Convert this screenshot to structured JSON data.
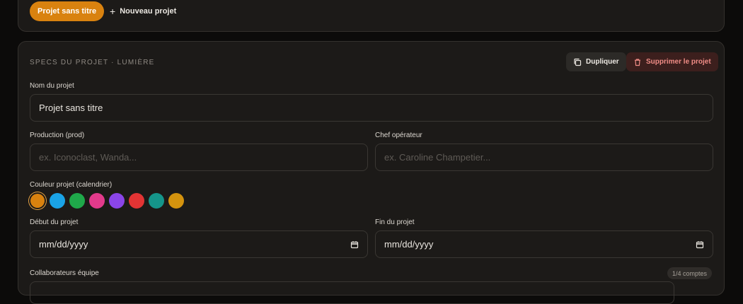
{
  "tabs": {
    "active_project": "Projet sans titre",
    "new_project_label": "Nouveau projet"
  },
  "specs": {
    "section_title": "SPECS DU PROJET · LUMIÈRE",
    "duplicate_label": "Dupliquer",
    "delete_label": "Supprimer le projet",
    "name_label": "Nom du projet",
    "name_value": "Projet sans titre",
    "production_label": "Production (prod)",
    "production_placeholder": "ex. Iconoclast, Wanda...",
    "dop_label": "Chef opérateur",
    "dop_placeholder": "ex. Caroline Champetier...",
    "color_label": "Couleur projet (calendrier)",
    "colors": [
      "#d9820f",
      "#1aa3e6",
      "#1fa84a",
      "#e23a8b",
      "#8a45e8",
      "#e23434",
      "#15958a",
      "#d4930e"
    ],
    "selected_color_index": 0,
    "start_label": "Début du projet",
    "start_value": "mm/dd/yyyy",
    "end_label": "Fin du projet",
    "end_value": "mm/dd/yyyy",
    "team_label": "Collaborateurs équipe",
    "team_count": "1/4 comptes"
  },
  "colors": {
    "accent": "#d9820f",
    "danger_text": "#f08c86",
    "card_bg": "#1c1a18"
  }
}
